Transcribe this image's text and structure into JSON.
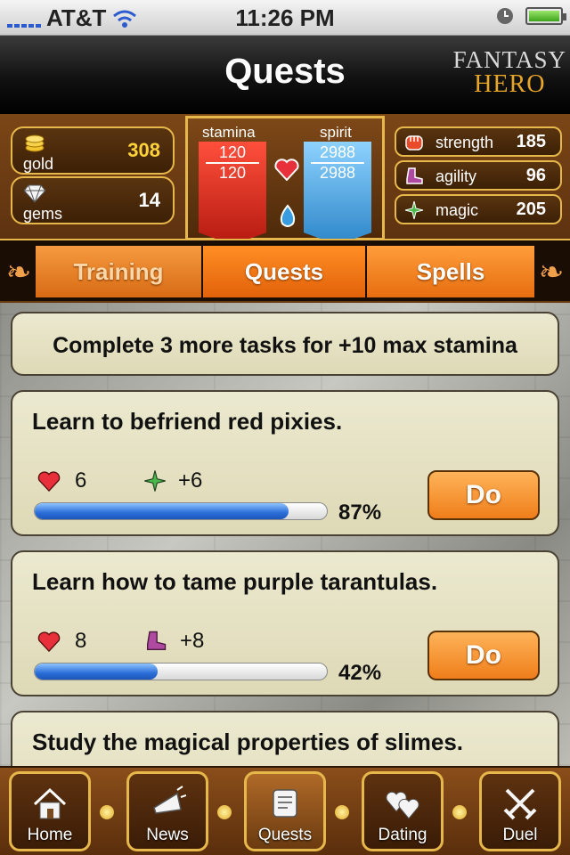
{
  "status_bar": {
    "carrier": "AT&T",
    "time": "11:26 PM"
  },
  "nav": {
    "title": "Quests",
    "logo_line1": "FANTASY",
    "logo_line2": "HERO"
  },
  "stats": {
    "gold": {
      "label": "gold",
      "value": "308"
    },
    "gems": {
      "label": "gems",
      "value": "14"
    },
    "stamina": {
      "label": "stamina",
      "current": "120",
      "max": "120"
    },
    "spirit": {
      "label": "spirit",
      "current": "2988",
      "max": "2988"
    },
    "strength": {
      "label": "strength",
      "value": "185"
    },
    "agility": {
      "label": "agility",
      "value": "96"
    },
    "magic": {
      "label": "magic",
      "value": "205"
    }
  },
  "tabs": [
    {
      "label": "Training"
    },
    {
      "label": "Quests"
    },
    {
      "label": "Spells"
    }
  ],
  "banner": "Complete 3 more tasks for +10 max stamina",
  "quests": [
    {
      "title": "Learn to befriend red pixies.",
      "cost": "6",
      "reward": "+6",
      "reward_icon": "magic-icon",
      "progress": 0.87,
      "percent": "87%",
      "action": "Do"
    },
    {
      "title": "Learn how to tame purple tarantulas.",
      "cost": "8",
      "reward": "+8",
      "reward_icon": "agility-icon",
      "progress": 0.42,
      "percent": "42%",
      "action": "Do"
    },
    {
      "title": "Study the magical properties of slimes."
    }
  ],
  "tabbar": [
    {
      "label": "Home",
      "icon": "home-icon"
    },
    {
      "label": "News",
      "icon": "megaphone-icon"
    },
    {
      "label": "Quests",
      "icon": "scroll-icon",
      "active": true
    },
    {
      "label": "Dating",
      "icon": "hearts-icon"
    },
    {
      "label": "Duel",
      "icon": "crossed-swords-icon"
    }
  ],
  "colors": {
    "accent_orange": "#ef7e1a",
    "gold_trim": "#e6b74a",
    "progress_blue": "#2a6ed8"
  }
}
